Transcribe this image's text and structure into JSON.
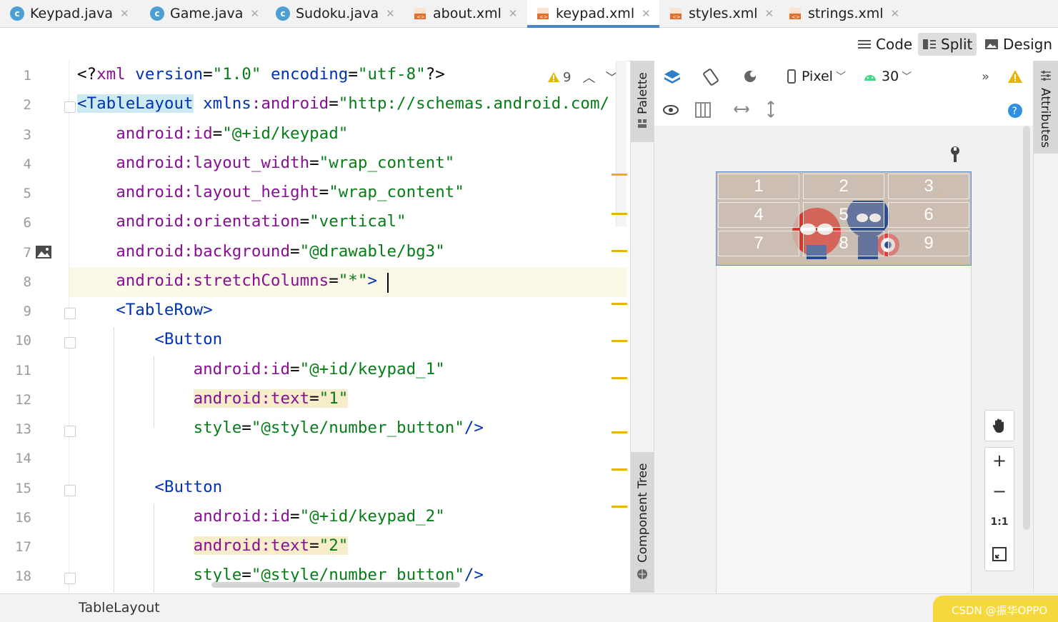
{
  "tabs": [
    {
      "label": "Keypad.java",
      "type": "java"
    },
    {
      "label": "Game.java",
      "type": "java"
    },
    {
      "label": "Sudoku.java",
      "type": "java"
    },
    {
      "label": "about.xml",
      "type": "xml"
    },
    {
      "label": "keypad.xml",
      "type": "xml",
      "active": true
    },
    {
      "label": "styles.xml",
      "type": "xml"
    },
    {
      "label": "strings.xml",
      "type": "xml"
    }
  ],
  "view_modes": {
    "code": "Code",
    "split": "Split",
    "design": "Design",
    "selected": "Split"
  },
  "editor": {
    "warning_count": "9",
    "line_numbers": [
      "1",
      "2",
      "3",
      "4",
      "5",
      "6",
      "7",
      "8",
      "9",
      "10",
      "11",
      "12",
      "13",
      "14",
      "15",
      "16",
      "17",
      "18"
    ],
    "lines": [
      "<?xml version=\"1.0\" encoding=\"utf-8\"?>",
      "<TableLayout xmlns:android=\"http://schemas.android.com/",
      "    android:id=\"@+id/keypad\"",
      "    android:layout_width=\"wrap_content\"",
      "    android:layout_height=\"wrap_content\"",
      "    android:orientation=\"vertical\"",
      "    android:background=\"@drawable/bg3\"",
      "    android:stretchColumns=\"*\">",
      "    <TableRow>",
      "        <Button",
      "            android:id=\"@+id/keypad_1\"",
      "            android:text=\"1\"",
      "            style=\"@style/number_button\"/>",
      "",
      "        <Button",
      "            android:id=\"@+id/keypad_2\"",
      "            android:text=\"2\"",
      "            style=\"@style/number_button\"/>"
    ]
  },
  "side_tabs": {
    "palette": "Palette",
    "component_tree": "Component Tree",
    "attributes": "Attributes"
  },
  "design_toolbar": {
    "device": "Pixel",
    "api_level": "30"
  },
  "preview": {
    "keys": [
      "1",
      "2",
      "3",
      "4",
      "5",
      "6",
      "7",
      "8",
      "9"
    ]
  },
  "zoom_controls": {
    "zoom_in": "+",
    "zoom_out": "−",
    "actual_size": "1:1"
  },
  "status": {
    "breadcrumb": "TableLayout",
    "watermark": "CSDN @振华OPPO"
  },
  "colors": {
    "accent": "#4a86c7",
    "attr": "#871094",
    "value": "#067d17",
    "tag": "#0033b3",
    "warning": "#e8b400"
  }
}
